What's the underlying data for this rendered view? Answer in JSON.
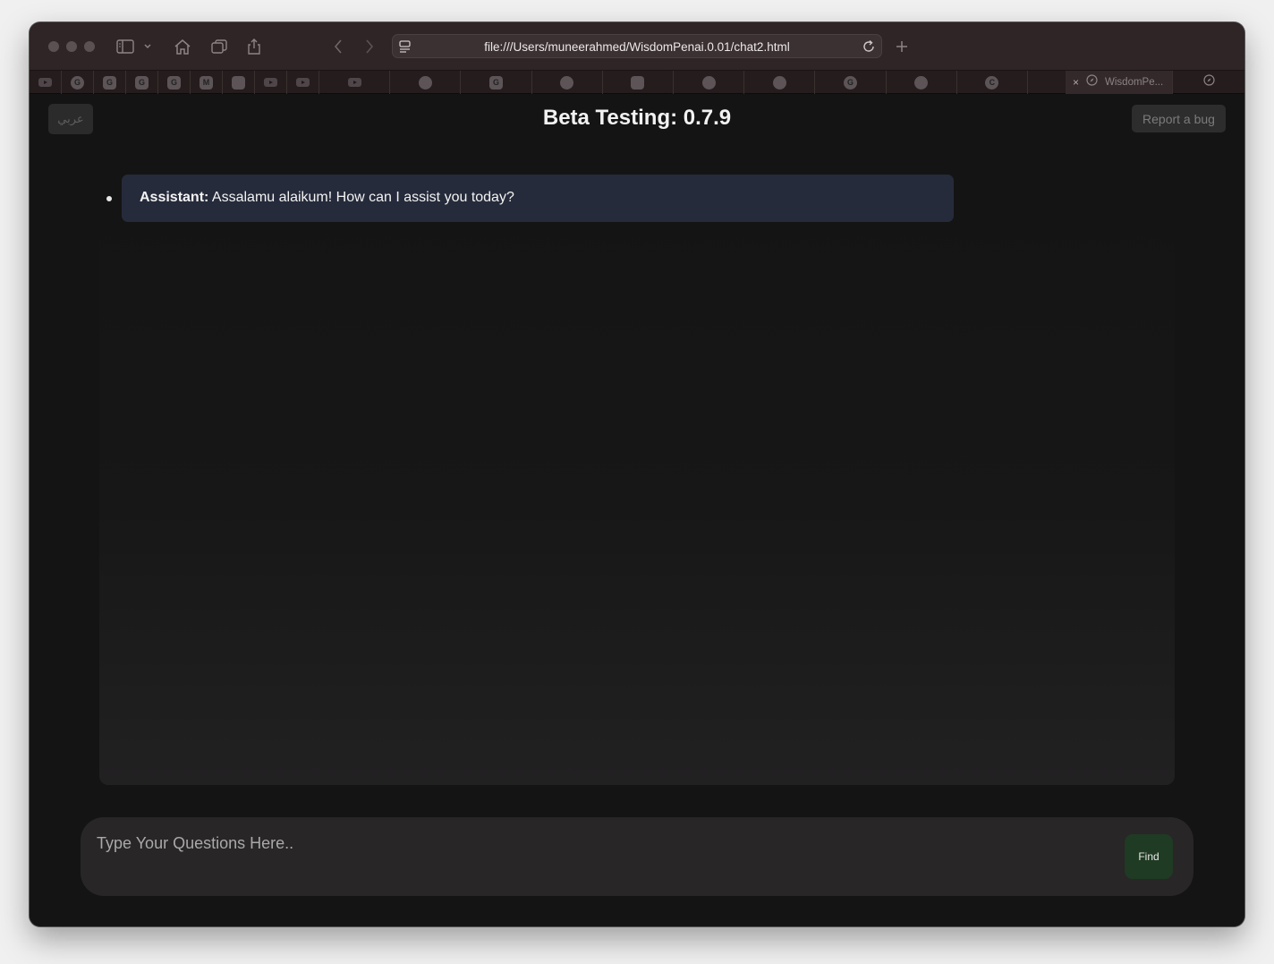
{
  "browser": {
    "address_bar": {
      "url": "file:///Users/muneerahmed/WisdomPenai.0.01/chat2.html"
    },
    "tabs": [
      {
        "icon": "youtube-icon",
        "glyph": ""
      },
      {
        "icon": "grammarly-icon",
        "glyph": "G"
      },
      {
        "icon": "google-icon",
        "glyph": "G"
      },
      {
        "icon": "google-icon",
        "glyph": "G"
      },
      {
        "icon": "google-icon",
        "glyph": "G"
      },
      {
        "icon": "gmail-icon",
        "glyph": "M"
      },
      {
        "icon": "app-icon",
        "glyph": ""
      },
      {
        "icon": "youtube-icon",
        "glyph": ""
      },
      {
        "icon": "youtube-icon",
        "glyph": ""
      },
      {
        "icon": "youtube-icon",
        "glyph": ""
      },
      {
        "icon": "chrome-icon",
        "glyph": ""
      },
      {
        "icon": "google-icon",
        "glyph": "G"
      },
      {
        "icon": "compass-icon",
        "glyph": ""
      },
      {
        "icon": "x-icon",
        "glyph": ""
      },
      {
        "icon": "openai-icon",
        "glyph": ""
      },
      {
        "icon": "openai-icon",
        "glyph": ""
      },
      {
        "icon": "grammarly-icon",
        "glyph": "G"
      },
      {
        "icon": "openai-icon",
        "glyph": ""
      },
      {
        "icon": "c-icon",
        "glyph": "C"
      }
    ],
    "active_tab": {
      "title": "WisdomPe...",
      "close": "×"
    }
  },
  "page": {
    "language_button": "عربي",
    "title": "Beta Testing: 0.7.9",
    "report_button": "Report a bug"
  },
  "chat": {
    "messages": [
      {
        "speaker": "Assistant:",
        "text": " Assalamu alaikum! How can I assist you today?"
      }
    ]
  },
  "composer": {
    "placeholder": "Type Your Questions Here..",
    "value": "",
    "submit_label": "Find"
  },
  "colors": {
    "toolbar": "#2f2526",
    "page_background": "#141414",
    "assistant_bubble": "#262b3b",
    "find_button": "#1f3b23"
  }
}
